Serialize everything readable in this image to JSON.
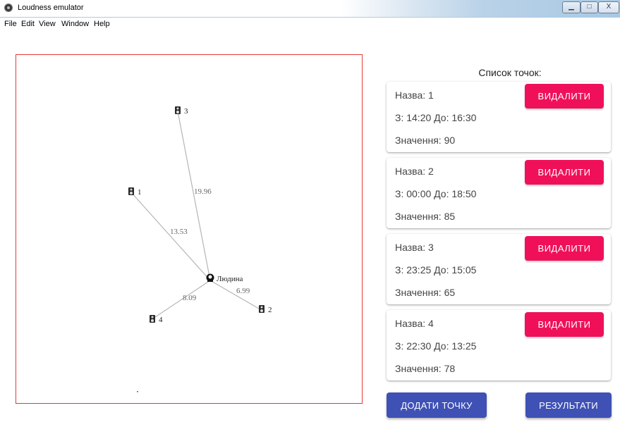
{
  "window": {
    "title": "Loudness emulator",
    "icon": "app-icon",
    "controls": {
      "minimize": "▁",
      "maximize": "□",
      "close": "X"
    }
  },
  "menu": [
    "File",
    "Edit",
    "View",
    "Window",
    "Help"
  ],
  "map": {
    "person": {
      "label": "Людина",
      "icon": "person-icon"
    },
    "points": [
      {
        "label": "1",
        "icon": "speaker-icon",
        "distance": "13.53"
      },
      {
        "label": "2",
        "icon": "speaker-icon",
        "distance": "6.99"
      },
      {
        "label": "3",
        "icon": "speaker-icon",
        "distance": "19.96"
      },
      {
        "label": "4",
        "icon": "speaker-icon",
        "distance": "8.09"
      }
    ],
    "colors": {
      "border": "#e53935",
      "line": "#b5b5b5"
    }
  },
  "list": {
    "title": "Список точок:",
    "items": [
      {
        "name": "Назва: 1",
        "time": "З: 14:20 До: 16:30",
        "value": "Значення: 90",
        "delete_label": "ВИДАЛИТИ"
      },
      {
        "name": "Назва: 2",
        "time": "З: 00:00 До: 18:50",
        "value": "Значення: 85",
        "delete_label": "ВИДАЛИТИ"
      },
      {
        "name": "Назва: 3",
        "time": "З: 23:25 До: 15:05",
        "value": "Значення: 65",
        "delete_label": "ВИДАЛИТИ"
      },
      {
        "name": "Назва: 4",
        "time": "З: 22:30 До: 13:25",
        "value": "Значення: 78",
        "delete_label": "ВИДАЛИТИ"
      }
    ]
  },
  "actions": {
    "add_point": "ДОДАТИ ТОЧКУ",
    "results": "РЕЗУЛЬТАТИ"
  },
  "colors": {
    "delete_button": "#f0105a",
    "primary_button": "#3f51b5"
  }
}
